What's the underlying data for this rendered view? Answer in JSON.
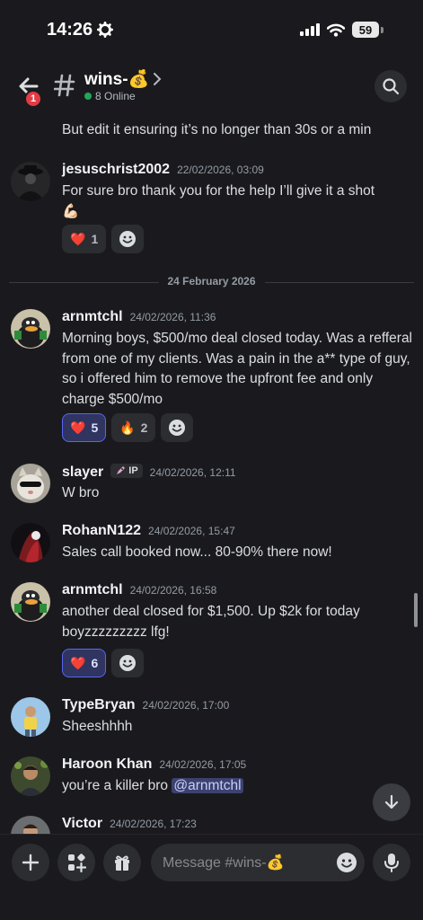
{
  "status": {
    "time": "14:26",
    "battery": "59"
  },
  "header": {
    "channel": "wins-💰",
    "online": "8 Online",
    "back_badge": "1"
  },
  "prev_message": "But edit it ensuring it’s no longer than 30s or a min",
  "divider": "24 February 2026",
  "messages": [
    {
      "author": "jesuschrist2002",
      "time": "22/02/2026, 03:09",
      "text": "For sure bro thank you for the help I’ll give it a shot",
      "extra": "💪🏻",
      "reactions": [
        {
          "emoji": "❤️",
          "count": "1"
        }
      ]
    },
    {
      "author": "arnmtchl",
      "time": "24/02/2026, 11:36",
      "text": "Morning boys, $500/mo deal closed today. Was a refferal from one of my clients. Was a pain in the a** type of guy, so i offered him to remove the upfront fee and only charge $500/mo",
      "reactions": [
        {
          "emoji": "❤️",
          "count": "5"
        },
        {
          "emoji": "🔥",
          "count": "2"
        }
      ]
    },
    {
      "author": "slayer",
      "tag": "IP",
      "time": "24/02/2026, 12:11",
      "text": "W bro"
    },
    {
      "author": "RohanN122",
      "time": "24/02/2026, 15:47",
      "text": "Sales call booked now... 80-90% there now!"
    },
    {
      "author": "arnmtchl",
      "time": "24/02/2026, 16:58",
      "text": "another deal closed for $1,500. Up $2k for today boyzzzzzzzzz lfg!",
      "reactions": [
        {
          "emoji": "❤️",
          "count": "6"
        }
      ]
    },
    {
      "author": "TypeBryan",
      "time": "24/02/2026, 17:00",
      "text": "Sheeshhhh"
    },
    {
      "author": "Haroon Khan",
      "time": "24/02/2026, 17:05",
      "text": "you’re a killer bro",
      "mention": "@arnmtchl"
    },
    {
      "author": "Victor",
      "time": "24/02/2026, 17:23"
    }
  ],
  "composer": {
    "placeholder": "Message #wins-💰"
  },
  "colors": {
    "background": "#1a1a1e",
    "accent": "#5865f2",
    "online": "#23a55a",
    "badge": "#e23b45"
  },
  "icons": [
    "gear-icon",
    "signal-icon",
    "wifi-icon",
    "back-arrow-icon",
    "hash-icon",
    "chevron-right-icon",
    "search-icon",
    "add-reaction-icon",
    "arrow-down-icon",
    "plus-icon",
    "apps-icon",
    "gift-icon",
    "emoji-icon",
    "microphone-icon"
  ]
}
